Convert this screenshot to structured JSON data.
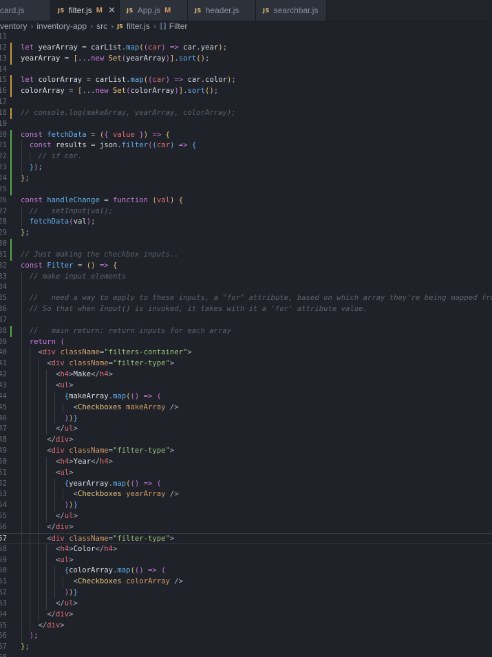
{
  "tabs": [
    {
      "label": "card.js",
      "modified": "",
      "active": false,
      "icon": "js-icon"
    },
    {
      "label": "filter.js",
      "modified": "M",
      "active": true,
      "icon": "js-icon"
    },
    {
      "label": "App.js",
      "modified": "M",
      "active": false,
      "icon": "js-icon"
    },
    {
      "label": "header.js",
      "modified": "",
      "active": false,
      "icon": "js-icon"
    },
    {
      "label": "searchbar.js",
      "modified": "",
      "active": false,
      "icon": "js-icon"
    }
  ],
  "breadcrumb": {
    "items": [
      "ventory",
      "inventory-app",
      "src",
      "filter.js",
      "Filter"
    ],
    "file_icon": "JS",
    "symbol_icon": "⟦⟧"
  },
  "editor": {
    "lines": [
      {
        "n": "11",
        "git": "",
        "guides": 0,
        "code": ""
      },
      {
        "n": "12",
        "git": "mod",
        "guides": 0,
        "code": "<span class='kw'>let</span> <span class='tx'>yearArray</span> <span class='pn'>=</span> <span class='tx'>carList</span><span class='pn'>.</span><span class='fn'>map</span><span class='br'>(</span><span class='br2'>(</span><span class='nm'>car</span><span class='br2'>)</span> <span class='kw'>=&gt;</span> <span class='tx'>car</span><span class='pn'>.</span><span class='tx'>year</span><span class='br'>)</span><span class='pn'>;</span>"
      },
      {
        "n": "13",
        "git": "mod",
        "guides": 0,
        "code": "<span class='tx'>yearArray</span> <span class='pn'>=</span> <span class='br'>[</span><span class='pn'>...</span><span class='kw'>new</span> <span class='st'>Set</span><span class='br2'>(</span><span class='tx'>yearArray</span><span class='br2'>)</span><span class='br'>]</span><span class='pn'>.</span><span class='fn'>sort</span><span class='br'>()</span><span class='pn'>;</span>"
      },
      {
        "n": "14",
        "git": "",
        "guides": 0,
        "code": ""
      },
      {
        "n": "15",
        "git": "mod",
        "guides": 0,
        "code": "<span class='kw'>let</span> <span class='tx'>colorArray</span> <span class='pn'>=</span> <span class='tx'>carList</span><span class='pn'>.</span><span class='fn'>map</span><span class='br'>(</span><span class='br2'>(</span><span class='nm'>car</span><span class='br2'>)</span> <span class='kw'>=&gt;</span> <span class='tx'>car</span><span class='pn'>.</span><span class='tx'>color</span><span class='br'>)</span><span class='pn'>;</span>"
      },
      {
        "n": "16",
        "git": "mod",
        "guides": 0,
        "code": "<span class='tx'>colorArray</span> <span class='pn'>=</span> <span class='br'>[</span><span class='pn'>...</span><span class='kw'>new</span> <span class='st'>Set</span><span class='br2'>(</span><span class='tx'>colorArray</span><span class='br2'>)</span><span class='br'>]</span><span class='pn'>.</span><span class='fn'>sort</span><span class='br'>()</span><span class='pn'>;</span>"
      },
      {
        "n": "17",
        "git": "",
        "guides": 0,
        "code": ""
      },
      {
        "n": "18",
        "git": "mod",
        "guides": 0,
        "code": "<span class='cm'>// console.log(makeArray, yearArray, colorArray);</span>"
      },
      {
        "n": "19",
        "git": "",
        "guides": 0,
        "code": ""
      },
      {
        "n": "20",
        "git": "add",
        "guides": 0,
        "code": "<span class='kw'>const</span> <span class='fn'>fetchData</span> <span class='pn'>=</span> <span class='br'>(</span><span class='br2'>{</span> <span class='nm'>value</span> <span class='br2'>}</span><span class='br'>)</span> <span class='kw'>=&gt;</span> <span class='br'>{</span>"
      },
      {
        "n": "21",
        "git": "add",
        "guides": 1,
        "code": "  <span class='kw'>const</span> <span class='tx'>results</span> <span class='pn'>=</span> <span class='tx'>json</span><span class='pn'>.</span><span class='fn'>filter</span><span class='br2'>(</span><span class='br3'>(</span><span class='nm'>car</span><span class='br3'>)</span> <span class='kw'>=&gt;</span> <span class='br3'>{</span>"
      },
      {
        "n": "22",
        "git": "add",
        "guides": 2,
        "code": "    <span class='cm'>// if car.</span>"
      },
      {
        "n": "23",
        "git": "add",
        "guides": 1,
        "code": "  <span class='br3'>}</span><span class='br2'>)</span><span class='pn'>;</span>"
      },
      {
        "n": "24",
        "git": "add",
        "guides": 0,
        "code": "<span class='br'>}</span><span class='pn'>;</span>"
      },
      {
        "n": "25",
        "git": "add",
        "guides": 0,
        "code": ""
      },
      {
        "n": "26",
        "git": "",
        "guides": 0,
        "code": "<span class='kw'>const</span> <span class='fn'>handleChange</span> <span class='pn'>=</span> <span class='kw'>function</span> <span class='br'>(</span><span class='nm'>val</span><span class='br'>)</span> <span class='br'>{</span>"
      },
      {
        "n": "27",
        "git": "",
        "guides": 1,
        "code": "  <span class='cm'>//   setInput(val);</span>"
      },
      {
        "n": "28",
        "git": "",
        "guides": 1,
        "code": "  <span class='fn'>fetchData</span><span class='br2'>(</span><span class='tx'>val</span><span class='br2'>)</span><span class='pn'>;</span>"
      },
      {
        "n": "29",
        "git": "",
        "guides": 0,
        "code": "<span class='br'>}</span><span class='pn'>;</span>"
      },
      {
        "n": "30",
        "git": "add",
        "guides": 0,
        "code": ""
      },
      {
        "n": "31",
        "git": "add",
        "guides": 0,
        "code": "<span class='cm'>// Just making the checkbox inputs..</span>"
      },
      {
        "n": "32",
        "git": "",
        "guides": 0,
        "code": "<span class='kw'>const</span> <span class='fn'>Filter</span> <span class='pn'>=</span> <span class='br'>()</span> <span class='kw'>=&gt;</span> <span class='br'>{</span>"
      },
      {
        "n": "33",
        "git": "",
        "guides": 1,
        "code": "  <span class='cm'>// make input elements</span>"
      },
      {
        "n": "34",
        "git": "",
        "guides": 1,
        "code": ""
      },
      {
        "n": "35",
        "git": "",
        "guides": 1,
        "code": "  <span class='cm'>//   need a way to apply to these inputs, a \"for\" attribute, based on which array they're being mapped from ..</span>"
      },
      {
        "n": "36",
        "git": "",
        "guides": 1,
        "code": "  <span class='cm'>// So that when Input() is invoked, it takes with it a 'for' attribute value.</span>"
      },
      {
        "n": "37",
        "git": "",
        "guides": 1,
        "code": ""
      },
      {
        "n": "38",
        "git": "add",
        "guides": 1,
        "code": "  <span class='cm'>//   main return: return inputs for each array</span>"
      },
      {
        "n": "39",
        "git": "",
        "guides": 1,
        "code": "  <span class='kw'>return</span> <span class='br2'>(</span>"
      },
      {
        "n": "40",
        "git": "",
        "guides": 2,
        "code": "    <span class='pn'>&lt;</span><span class='tg'>div</span> <span class='at'>className</span><span class='pn'>=</span><span class='sr'>\"filters-container\"</span><span class='pn'>&gt;</span>"
      },
      {
        "n": "41",
        "git": "",
        "guides": 3,
        "code": "      <span class='pn'>&lt;</span><span class='tg'>div</span> <span class='at'>className</span><span class='pn'>=</span><span class='sr'>\"filter-type\"</span><span class='pn'>&gt;</span>"
      },
      {
        "n": "42",
        "git": "",
        "guides": 4,
        "code": "        <span class='pn'>&lt;</span><span class='tg'>h4</span><span class='pn'>&gt;</span><span class='tx'>Make</span><span class='pn'>&lt;/</span><span class='tg'>h4</span><span class='pn'>&gt;</span>"
      },
      {
        "n": "43",
        "git": "",
        "guides": 4,
        "code": "        <span class='pn'>&lt;</span><span class='tg'>ul</span><span class='pn'>&gt;</span>"
      },
      {
        "n": "44",
        "git": "",
        "guides": 5,
        "code": "          <span class='br3'>{</span><span class='tx'>makeArray</span><span class='pn'>.</span><span class='fn'>map</span><span class='br'>(</span><span class='br2'>()</span> <span class='kw'>=&gt;</span> <span class='br2'>(</span>"
      },
      {
        "n": "45",
        "git": "",
        "guides": 6,
        "code": "            <span class='pn'>&lt;</span><span class='st'>Checkboxes</span> <span class='at'>makeArray</span> <span class='pn'>/&gt;</span>"
      },
      {
        "n": "46",
        "git": "",
        "guides": 5,
        "code": "          <span class='br2'>)</span><span class='br'>)</span><span class='br3'>}</span>"
      },
      {
        "n": "47",
        "git": "",
        "guides": 4,
        "code": "        <span class='pn'>&lt;/</span><span class='tg'>ul</span><span class='pn'>&gt;</span>"
      },
      {
        "n": "48",
        "git": "",
        "guides": 3,
        "code": "      <span class='pn'>&lt;/</span><span class='tg'>div</span><span class='pn'>&gt;</span>"
      },
      {
        "n": "49",
        "git": "",
        "guides": 3,
        "code": "      <span class='pn'>&lt;</span><span class='tg'>div</span> <span class='at'>className</span><span class='pn'>=</span><span class='sr'>\"filter-type\"</span><span class='pn'>&gt;</span>"
      },
      {
        "n": "50",
        "git": "",
        "guides": 4,
        "code": "        <span class='pn'>&lt;</span><span class='tg'>h4</span><span class='pn'>&gt;</span><span class='tx'>Year</span><span class='pn'>&lt;/</span><span class='tg'>h4</span><span class='pn'>&gt;</span>"
      },
      {
        "n": "51",
        "git": "",
        "guides": 4,
        "code": "        <span class='pn'>&lt;</span><span class='tg'>ul</span><span class='pn'>&gt;</span>"
      },
      {
        "n": "52",
        "git": "",
        "guides": 5,
        "code": "          <span class='br3'>{</span><span class='tx'>yearArray</span><span class='pn'>.</span><span class='fn'>map</span><span class='br'>(</span><span class='br2'>()</span> <span class='kw'>=&gt;</span> <span class='br2'>(</span>"
      },
      {
        "n": "53",
        "git": "",
        "guides": 6,
        "code": "            <span class='pn'>&lt;</span><span class='st'>Checkboxes</span> <span class='at'>yearArray</span> <span class='pn'>/&gt;</span>"
      },
      {
        "n": "54",
        "git": "",
        "guides": 5,
        "code": "          <span class='br2'>)</span><span class='br'>)</span><span class='br3'>}</span>"
      },
      {
        "n": "55",
        "git": "",
        "guides": 4,
        "code": "        <span class='pn'>&lt;/</span><span class='tg'>ul</span><span class='pn'>&gt;</span>"
      },
      {
        "n": "56",
        "git": "",
        "guides": 3,
        "code": "      <span class='pn'>&lt;/</span><span class='tg'>div</span><span class='pn'>&gt;</span>"
      },
      {
        "n": "57",
        "git": "",
        "guides": 3,
        "code": "      <span class='pn'>&lt;</span><span class='tg'>div</span> <span class='at'>className</span><span class='pn'>=</span><span class='sr'>\"filter-type\"</span><span class='pn'>&gt;</span>",
        "current": true
      },
      {
        "n": "58",
        "git": "",
        "guides": 4,
        "code": "        <span class='pn'>&lt;</span><span class='tg'>h4</span><span class='pn'>&gt;</span><span class='tx'>Color</span><span class='pn'>&lt;/</span><span class='tg'>h4</span><span class='pn'>&gt;</span>"
      },
      {
        "n": "59",
        "git": "",
        "guides": 4,
        "code": "        <span class='pn'>&lt;</span><span class='tg'>ul</span><span class='pn'>&gt;</span>"
      },
      {
        "n": "60",
        "git": "",
        "guides": 5,
        "code": "          <span class='br3'>{</span><span class='tx'>colorArray</span><span class='pn'>.</span><span class='fn'>map</span><span class='br'>(</span><span class='br2'>()</span> <span class='kw'>=&gt;</span> <span class='br2'>(</span>"
      },
      {
        "n": "61",
        "git": "",
        "guides": 6,
        "code": "            <span class='pn'>&lt;</span><span class='st'>Checkboxes</span> <span class='at'>colorArray</span> <span class='pn'>/&gt;</span>"
      },
      {
        "n": "62",
        "git": "",
        "guides": 5,
        "code": "          <span class='br2'>)</span><span class='br'>)</span><span class='br3'>}</span>"
      },
      {
        "n": "63",
        "git": "",
        "guides": 4,
        "code": "        <span class='pn'>&lt;/</span><span class='tg'>ul</span><span class='pn'>&gt;</span>"
      },
      {
        "n": "64",
        "git": "",
        "guides": 3,
        "code": "      <span class='pn'>&lt;/</span><span class='tg'>div</span><span class='pn'>&gt;</span>"
      },
      {
        "n": "65",
        "git": "",
        "guides": 2,
        "code": "    <span class='pn'>&lt;/</span><span class='tg'>div</span><span class='pn'>&gt;</span>"
      },
      {
        "n": "66",
        "git": "",
        "guides": 1,
        "code": "  <span class='br2'>)</span><span class='pn'>;</span>"
      },
      {
        "n": "67",
        "git": "",
        "guides": 0,
        "code": "<span class='br'>}</span><span class='pn'>;</span>"
      },
      {
        "n": "68",
        "git": "",
        "guides": 0,
        "code": ""
      }
    ]
  }
}
